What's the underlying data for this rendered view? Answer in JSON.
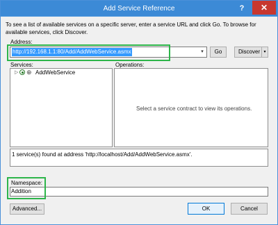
{
  "window": {
    "title": "Add Service Reference",
    "help_label": "?",
    "close_label": "✕"
  },
  "instructions": "To see a list of available services on a specific server, enter a service URL and click Go. To browse for available services, click Discover.",
  "address": {
    "label": "Address:",
    "value": "http://192.168.1.1:80/Add/AddWebService.asmx",
    "dropdown_glyph": "▾"
  },
  "buttons": {
    "go": "Go",
    "discover": "Discover",
    "discover_dropdown": "▾",
    "advanced": "Advanced...",
    "ok": "OK",
    "cancel": "Cancel"
  },
  "services": {
    "label": "Services:",
    "items": [
      {
        "expander": "▷",
        "label": "AddWebService"
      }
    ]
  },
  "operations": {
    "label": "Operations:",
    "empty_message": "Select a service contract to view its operations."
  },
  "status": "1 service(s) found at address 'http://localhost/Add/AddWebService.asmx'.",
  "namespace": {
    "label": "Namespace:",
    "value": "Addition"
  },
  "colors": {
    "title_bar": "#3c8ad6",
    "close_button": "#c7372f",
    "highlight": "#2db54a",
    "selection": "#3399ff"
  }
}
